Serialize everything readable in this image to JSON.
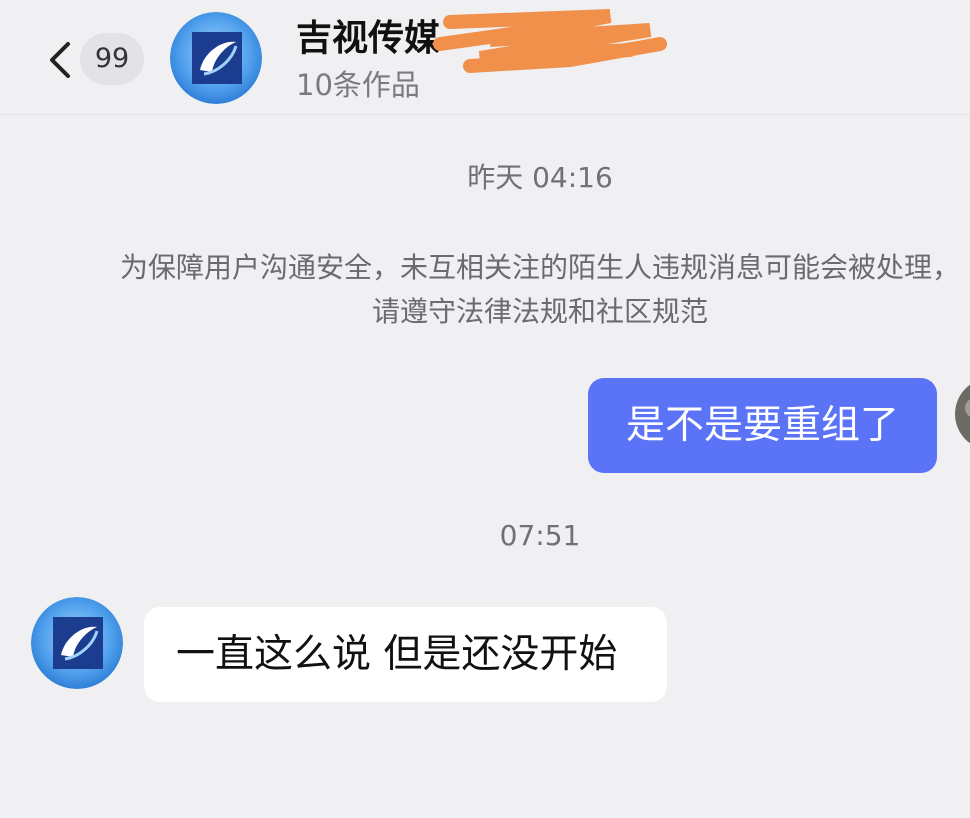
{
  "header": {
    "unread_count": "99",
    "contact_name": "吉视传媒 ~",
    "works_count": "10条作品"
  },
  "messages": {
    "timestamp_1": "昨天 04:16",
    "notice": "为保障用户沟通安全，未互相关注的陌生人违规消息可能会被处理，请遵守法律法规和社区规范",
    "outgoing_1": "是不是要重组了",
    "timestamp_2": "07:51",
    "incoming_1": "一直这么说 但是还没开始"
  },
  "colors": {
    "outgoing_bubble": "#5b73f6",
    "redaction": "#f0904a",
    "background": "#f0f0f2"
  },
  "icons": {
    "back": "chevron-left-icon",
    "avatar": "company-logo-avatar"
  }
}
